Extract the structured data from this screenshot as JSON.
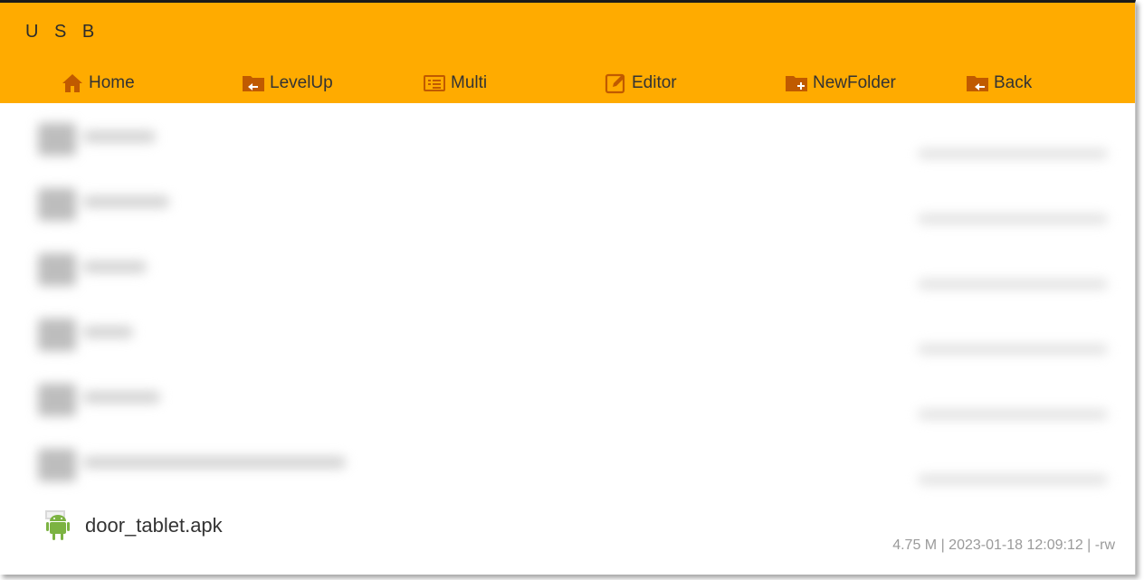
{
  "app": {
    "title": "U S B"
  },
  "toolbar": [
    {
      "id": "home",
      "label": "Home",
      "icon": "home-icon"
    },
    {
      "id": "levelup",
      "label": "LevelUp",
      "icon": "folder-levelup-icon"
    },
    {
      "id": "multi",
      "label": "Multi",
      "icon": "multi-select-icon"
    },
    {
      "id": "editor",
      "label": "Editor",
      "icon": "edit-icon"
    },
    {
      "id": "newfolder",
      "label": "NewFolder",
      "icon": "folder-add-icon"
    },
    {
      "id": "back",
      "label": "Back",
      "icon": "folder-back-icon"
    }
  ],
  "files": {
    "visible": {
      "name": "door_tablet.apk",
      "icon": "android-apk-icon",
      "meta": "4.75 M | 2023-01-18 12:09:12 | -rw"
    }
  },
  "colors": {
    "appbar": "#ffab00",
    "text": "#333333",
    "meta": "#9a9a9a"
  }
}
